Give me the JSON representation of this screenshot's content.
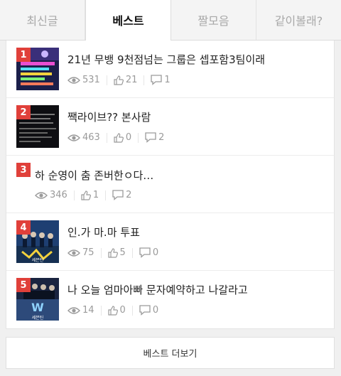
{
  "tabs": [
    {
      "label": "최신글"
    },
    {
      "label": "베스트"
    },
    {
      "label": "짤모음"
    },
    {
      "label": "같이볼래?"
    }
  ],
  "active_tab": "베스트",
  "posts": [
    {
      "rank": "1",
      "title": "21년 무뱅 9천점넘는 그룹은 셉포함3팀이래",
      "views": "531",
      "likes": "21",
      "comments": "1",
      "thumbnail": "chart-screenshot"
    },
    {
      "rank": "2",
      "title": "짹라이브?? 본사람",
      "views": "463",
      "likes": "0",
      "comments": "2",
      "thumbnail": "dark-chat-screenshot"
    },
    {
      "rank": "3",
      "title": "하 순영이 춤 존버한ㅇ다…",
      "views": "346",
      "likes": "1",
      "comments": "2",
      "thumbnail": null
    },
    {
      "rank": "4",
      "title": "인.가 마.마 투표",
      "views": "75",
      "likes": "5",
      "comments": "0",
      "thumbnail": "group-poster-blue"
    },
    {
      "rank": "5",
      "title": "나 오늘 엄마아빠 문자예약하고 나갈라고",
      "views": "14",
      "likes": "0",
      "comments": "0",
      "thumbnail": "group-poster-dark"
    }
  ],
  "thumb_texts": {
    "poster4_caption": "세븐틴",
    "poster5_caption": "세븐틴"
  },
  "more_button": {
    "label": "베스트 더보기"
  },
  "colors": {
    "rank_badge": "#e0403a",
    "meta_text": "#9a9a9a",
    "active_tab_text": "#111111",
    "inactive_tab_text": "#a8a8a8"
  },
  "icons": {
    "views": "eye-icon",
    "likes": "thumbs-up-icon",
    "comments": "comment-icon"
  }
}
